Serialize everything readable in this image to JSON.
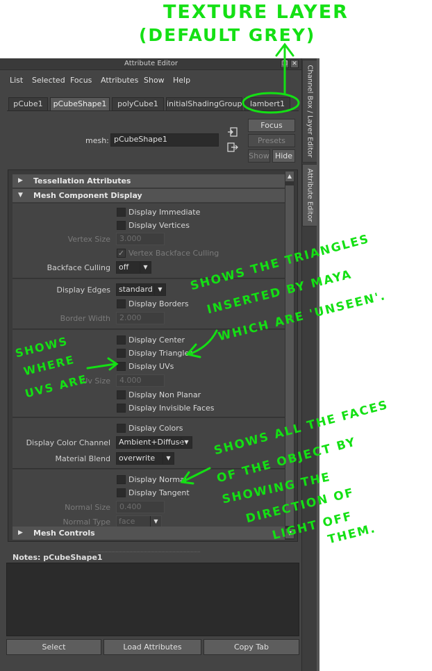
{
  "window": {
    "title": "Attribute Editor",
    "controls": [
      "restore-icon",
      "close-icon"
    ]
  },
  "menubar": [
    "List",
    "Selected",
    "Focus",
    "Attributes",
    "Show",
    "Help"
  ],
  "tabs": [
    {
      "label": "pCube1",
      "active": false
    },
    {
      "label": "pCubeShape1",
      "active": true
    },
    {
      "label": "polyCube1",
      "active": false
    },
    {
      "label": "initialShadingGroup",
      "active": false
    },
    {
      "label": "lambert1",
      "active": false
    }
  ],
  "node": {
    "label": "mesh:",
    "value": "pCubeShape1"
  },
  "side_buttons": {
    "focus": "Focus",
    "presets": "Presets",
    "show": "Show",
    "hide": "Hide"
  },
  "frames": {
    "tessellation": "Tessellation Attributes",
    "mesh_component": "Mesh Component Display",
    "mesh_controls": "Mesh Controls"
  },
  "attrs": {
    "display_immediate": "Display Immediate",
    "display_vertices": "Display Vertices",
    "vertex_size_label": "Vertex Size",
    "vertex_size_value": "3.000",
    "vertex_backface": "Vertex Backface Culling",
    "backface_label": "Backface Culling",
    "backface_value": "off",
    "display_edges_label": "Display Edges",
    "display_edges_value": "standard",
    "display_borders": "Display Borders",
    "border_width_label": "Border Width",
    "border_width_value": "2.000",
    "display_center": "Display Center",
    "display_triangles": "Display Triangles",
    "display_uvs": "Display UVs",
    "uv_size_label": "Uv Size",
    "uv_size_value": "4.000",
    "display_non_planar": "Display Non Planar",
    "display_invisible": "Display Invisible Faces",
    "display_colors": "Display Colors",
    "color_channel_label": "Display Color Channel",
    "color_channel_value": "Ambient+Diffuse",
    "material_blend_label": "Material Blend",
    "material_blend_value": "overwrite",
    "display_normal": "Display Normal",
    "display_tangent": "Display Tangent",
    "normal_size_label": "Normal Size",
    "normal_size_value": "0.400",
    "normal_type_label": "Normal Type",
    "normal_type_value": "face"
  },
  "notes": {
    "label": "Notes:",
    "node": "pCubeShape1"
  },
  "bottom_buttons": [
    "Select",
    "Load Attributes",
    "Copy Tab"
  ],
  "dock_tabs": [
    "Channel Box / Layer Editor",
    "Attribute Editor"
  ],
  "annotations": {
    "texture_line1": "TEXTURE LAYER",
    "texture_line2": "(DEFAULT GREY)",
    "triangles_line1": "SHOWS THE TRIANGLES",
    "triangles_line2": "INSERTED BY MAYA",
    "triangles_line3": "WHICH ARE 'UNSEEN'.",
    "uvs_line1": "SHOWS",
    "uvs_line2": "WHERE",
    "uvs_line3": "UVS ARE",
    "normal_line1": "SHOWS ALL THE FACES",
    "normal_line2": "OF THE OBJECT BY",
    "normal_line3": "SHOWING THE",
    "normal_line4": "DIRECTION OF",
    "normal_line5": "LIGHT OFF",
    "normal_line6": "THEM.",
    "color": "#14e014"
  }
}
